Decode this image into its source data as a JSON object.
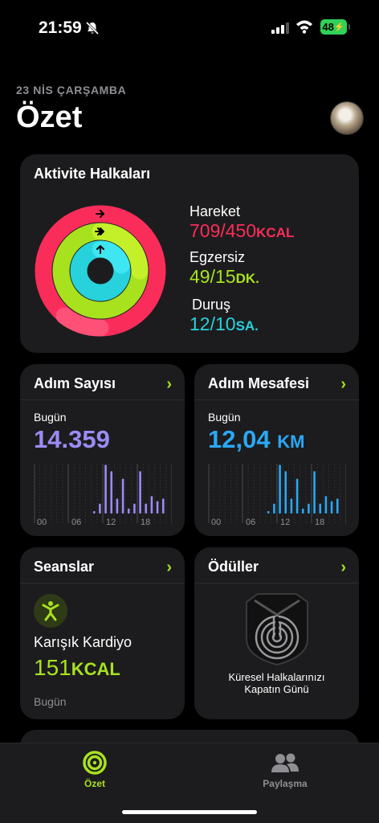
{
  "status_bar": {
    "time": "21:59",
    "battery": "48"
  },
  "header": {
    "date": "23 NİS ÇARŞAMBA",
    "title": "Özet"
  },
  "activity": {
    "title": "Aktivite Halkaları",
    "move": {
      "label": "Hareket",
      "value": "709/450",
      "unit": "KCAL",
      "color": "#fa2d5a",
      "fraction": 1.58
    },
    "exercise": {
      "label": "Egzersiz",
      "value": "49/15",
      "unit": "DK.",
      "color": "#a8e21f",
      "fraction": 3.27
    },
    "stand": {
      "label": "Duruş",
      "value": "12/10",
      "unit": "SA.",
      "color": "#27d2dc",
      "fraction": 1.2
    }
  },
  "steps": {
    "title": "Adım Sayısı",
    "today": "Bugün",
    "value": "14.359",
    "color": "#9b8cf5",
    "axis": [
      "00",
      "06",
      "12",
      "18"
    ],
    "chart_data": {
      "type": "bar",
      "x": [
        0,
        1,
        2,
        3,
        4,
        5,
        6,
        7,
        8,
        9,
        10,
        11,
        12,
        13,
        14,
        15,
        16,
        17,
        18,
        19,
        20,
        21,
        22,
        23
      ],
      "values": [
        0,
        0,
        0,
        0,
        0,
        0,
        0,
        0,
        0,
        0,
        0.05,
        0.2,
        0.98,
        0.85,
        0.3,
        0.7,
        0.1,
        0.2,
        0.85,
        0.2,
        0.35,
        0.25,
        0.3,
        0
      ]
    }
  },
  "distance": {
    "title": "Adım Mesafesi",
    "today": "Bugün",
    "value": "12,04",
    "unit": "KM",
    "color": "#2aa8f5",
    "axis": [
      "00",
      "06",
      "12",
      "18"
    ],
    "chart_data": {
      "type": "bar",
      "x": [
        0,
        1,
        2,
        3,
        4,
        5,
        6,
        7,
        8,
        9,
        10,
        11,
        12,
        13,
        14,
        15,
        16,
        17,
        18,
        19,
        20,
        21,
        22,
        23
      ],
      "values": [
        0,
        0,
        0,
        0,
        0,
        0,
        0,
        0,
        0,
        0,
        0.05,
        0.2,
        0.98,
        0.85,
        0.3,
        0.7,
        0.1,
        0.2,
        0.85,
        0.2,
        0.35,
        0.25,
        0.3,
        0
      ]
    }
  },
  "sessions": {
    "title": "Seanslar",
    "name": "Karışık Kardiyo",
    "value": "151",
    "unit": "KCAL",
    "date": "Bugün"
  },
  "awards": {
    "title": "Ödüller",
    "caption_line1": "Küresel Halkalarınızı",
    "caption_line2": "Kapatın Günü"
  },
  "tabs": {
    "summary": "Özet",
    "sharing": "Paylaşma"
  }
}
